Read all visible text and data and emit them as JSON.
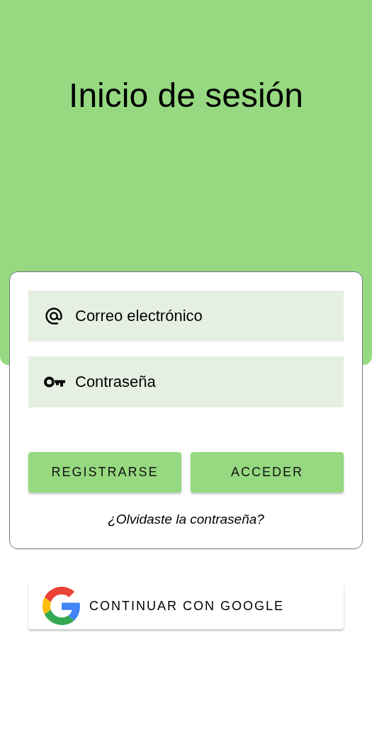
{
  "header": {
    "title": "Inicio de sesión"
  },
  "fields": [
    {
      "kind": "email",
      "placeholder": "Correo electrónico"
    },
    {
      "kind": "password",
      "placeholder": "Contraseña"
    }
  ],
  "buttons": [
    "REGISTRARSE",
    "ACCEDER"
  ],
  "forgot_link": "¿Olvidaste la contraseña?",
  "google_button": "CONTINUAR CON GOOGLE"
}
